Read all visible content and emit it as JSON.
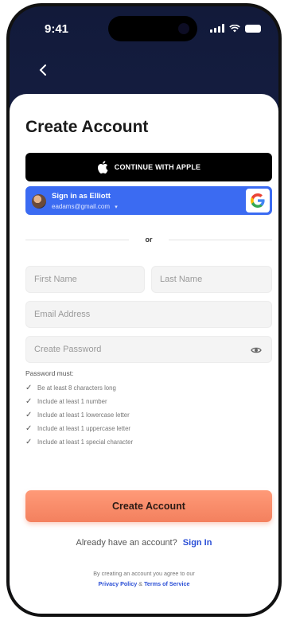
{
  "status": {
    "time": "9:41"
  },
  "nav": {
    "back_icon": "chevron-left-icon"
  },
  "page": {
    "title": "Create Account"
  },
  "apple": {
    "label": "CONTINUE WITH APPLE",
    "icon": "apple-logo-icon"
  },
  "google": {
    "name": "Sign in as Elliott",
    "email": "eadams@gmail.com",
    "icon": "google-g-icon",
    "color": "#3b6bf2"
  },
  "divider": {
    "label": "or"
  },
  "form": {
    "first_name_placeholder": "First Name",
    "last_name_placeholder": "Last Name",
    "email_placeholder": "Email Address",
    "password_placeholder": "Create Password"
  },
  "rules": {
    "title": "Password must:",
    "items": [
      "Be at least 8 characters long",
      "Include at least 1 number",
      "Include at least 1 lowercase letter",
      "Include at least 1 uppercase letter",
      "Include at least 1 special character"
    ]
  },
  "cta": {
    "label": "Create Account",
    "color": "#f3805e"
  },
  "signin": {
    "prompt": "Already have an account?",
    "link": "Sign In"
  },
  "terms": {
    "line1": "By creating an account you agree to our",
    "privacy": "Privacy Policy",
    "amp": "&",
    "tos": "Terms of Service"
  }
}
